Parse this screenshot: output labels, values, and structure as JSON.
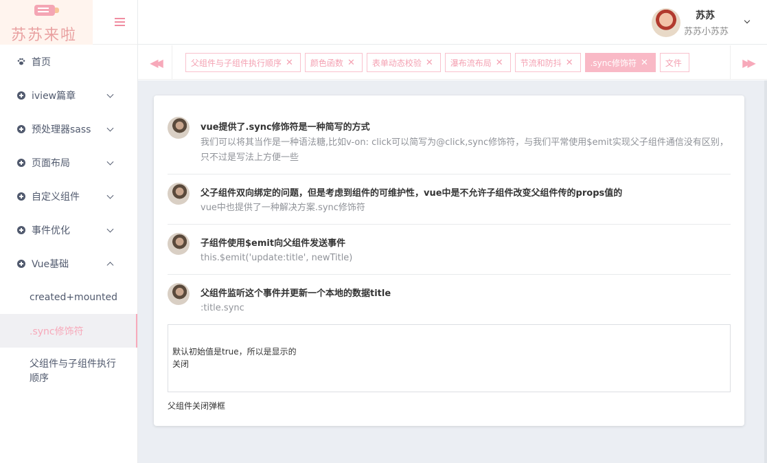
{
  "logo": {
    "text": "苏苏来啦"
  },
  "user": {
    "name": "苏苏",
    "subtitle": "苏苏小苏苏"
  },
  "sidebar": {
    "items": [
      {
        "label": "首页",
        "icon": "paw-icon"
      },
      {
        "label": "iview篇章",
        "icon": "plus-circle-icon"
      },
      {
        "label": "预处理器sass",
        "icon": "plus-circle-icon"
      },
      {
        "label": "页面布局",
        "icon": "plus-circle-icon"
      },
      {
        "label": "自定义组件",
        "icon": "plus-circle-icon"
      },
      {
        "label": "事件优化",
        "icon": "plus-circle-icon"
      },
      {
        "label": "Vue基础",
        "icon": "plus-circle-icon"
      }
    ],
    "subitems": [
      {
        "label": "created+mounted"
      },
      {
        "label": ".sync修饰符"
      },
      {
        "label": "父组件与子组件执行顺序"
      }
    ]
  },
  "tabs": [
    {
      "label": "父组件与子组件执行顺序"
    },
    {
      "label": "颜色函数"
    },
    {
      "label": "表单动态校验"
    },
    {
      "label": "瀑布流布局"
    },
    {
      "label": "节流和防抖"
    },
    {
      "label": ".sync修饰符"
    },
    {
      "label": "文件"
    }
  ],
  "icons": {
    "tab_prev": "◀◀",
    "tab_next": "▶▶",
    "tab_close": "✕"
  },
  "comments": [
    {
      "title": "vue提供了.sync修饰符是一种简写的方式",
      "desc": "我们可以将其当作是一种语法糖,比如v-on: click可以简写为@click,sync修饰符，与我们平常使用$emit实现父子组件通信没有区别，只不过是写法上方便一些"
    },
    {
      "title": "父子组件双向绑定的问题，但是考虑到组件的可维护性，vue中是不允许子组件改变父组件传的props值的",
      "desc": "vue中也提供了一种解决方案.sync修饰符"
    },
    {
      "title": "子组件使用$emit向父组件发送事件",
      "desc": "this.$emit('update:title', newTitle)"
    },
    {
      "title": "父组件监听这个事件并更新一个本地的数据title",
      "desc": ":title.sync"
    }
  ],
  "modal": {
    "text": "默认初始值是true，所以是显示的",
    "close": "关闭"
  },
  "parent_close": "父组件关闭弹框",
  "colors": {
    "accent": "#f7a9ba",
    "bg": "#ebeef3"
  }
}
